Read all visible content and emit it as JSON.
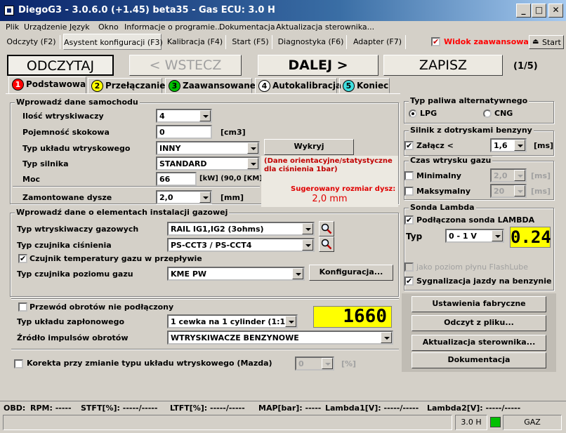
{
  "window": {
    "title": "DiegoG3 - 3.0.6.0 (+1.45) beta35 - Gas ECU: 3.0 H",
    "min": "_",
    "max": "□",
    "close": "✕"
  },
  "menu": [
    "Plik",
    "Urządzenie",
    "Język",
    "Okno",
    "Informacje o programie...",
    "Dokumentacja",
    "Aktualizacja sterownika..."
  ],
  "toptabs": [
    "Odczyty (F2)",
    "Asystent konfiguracji (F3)",
    "Kalibracja (F4)",
    "Start (F5)",
    "Diagnostyka (F6)",
    "Adapter (F7)"
  ],
  "advanced_view": {
    "label": "Widok zaawansowany",
    "checked": "✔"
  },
  "start": {
    "label": "Start"
  },
  "actions": {
    "read": "ODCZYTAJ",
    "back": "< WSTECZ",
    "next": "DALEJ  >",
    "save": "ZAPISZ",
    "step": "(1/5)"
  },
  "steps": [
    {
      "num": "1",
      "label": "Podstawowa",
      "color": "#ff0000"
    },
    {
      "num": "2",
      "label": "Przełączanie",
      "color": "#ffff00"
    },
    {
      "num": "3",
      "label": "Zaawansowane",
      "color": "#00c000"
    },
    {
      "num": "4",
      "label": "Autokalibracja",
      "color": "#ffffff"
    },
    {
      "num": "5",
      "label": "Koniec",
      "color": "#40e0e0"
    }
  ],
  "vehicle": {
    "title": "Wprowadź dane samochodu",
    "injectors_count_label": "Ilość wtryskiwaczy",
    "injectors_count": "4",
    "displacement_label": "Pojemność skokowa",
    "displacement": "0",
    "displacement_unit": "[cm3]",
    "injection_type_label": "Typ układu wtryskowego",
    "injection_type": "INNY",
    "detect_button": "Wykryj",
    "engine_type_label": "Typ silnika",
    "engine_type": "STANDARD",
    "power_label": "Moc",
    "power": "66",
    "power_unit": "[kW] (90,0 [KM])",
    "nozzle_label": "Zamontowane dysze",
    "nozzle": "2,0",
    "nozzle_unit": "[mm]",
    "note": "(Dane orientacyjne/statystyczne dla ciśnienia 1bar)",
    "suggest_label": "Sugerowany rozmiar dysz:",
    "suggest_value": "2,0 mm"
  },
  "gas": {
    "title": "Wprowadź dane o elementach instalacji gazowej",
    "injector_type_label": "Typ wtryskiwaczy gazowych",
    "injector_type": "RAIL IG1,IG2 (3ohms)",
    "pressure_sensor_label": "Typ czujnika ciśnienia",
    "pressure_sensor": "PS-CCT3 / PS-CCT4",
    "temp_sensor_label": "Czujnik temperatury gazu w przepływie",
    "temp_sensor_checked": "✔",
    "level_sensor_label": "Typ czujnika poziomu gazu",
    "level_sensor": "KME PW",
    "config_button": "Konfiguracja..."
  },
  "rpm": {
    "not_connected_label": "Przewód obrotów nie podłączony",
    "value": "1660",
    "ignition_label": "Typ układu zapłonowego",
    "ignition": "1 cewka na 1 cylinder (1:1)",
    "source_label": "Źródło impulsów obrotów",
    "source": "WTRYSKIWACZE BENZYNOWE",
    "mazda_label": "Korekta przy zmianie typu układu wtryskowego (Mazda)",
    "mazda_value": "0",
    "mazda_unit": "[%]"
  },
  "fuel": {
    "title": "Typ paliwa alternatywnego",
    "lpg": "LPG",
    "cng": "CNG"
  },
  "petrol": {
    "title": "Silnik z dotryskami benzyny",
    "enable_label": "Załącz <",
    "checked": "✔",
    "value": "1,6",
    "unit": "[ms]"
  },
  "gas_time": {
    "title": "Czas wtrysku gazu",
    "min_label": "Minimalny",
    "min": "2,0",
    "max_label": "Maksymalny",
    "max": "20",
    "unit": "[ms]"
  },
  "lambda": {
    "title": "Sonda Lambda",
    "connected_label": "Podłączona sonda LAMBDA",
    "checked": "✔",
    "type_label": "Typ",
    "type": "0 - 1 V",
    "value": "0.24",
    "flashlube_label": "jako poziom płynu FlashLube",
    "petrol_signal_label": "Sygnalizacja jazdy na benzynie"
  },
  "side_buttons": [
    "Ustawienia fabryczne",
    "Odczyt z pliku...",
    "Aktualizacja sterownika...",
    "Dokumentacja"
  ],
  "status_line": [
    "OBD:",
    "RPM: -----",
    "STFT[%]: -----/-----",
    "LTFT[%]: -----/-----",
    "MAP[bar]: -----",
    "Lambda1[V]: -----/-----",
    "Lambda2[V]: -----/-----"
  ],
  "statusbar": {
    "ecu": "3.0 H",
    "fuel": "GAZ",
    "indicator_color": "#00c000"
  }
}
